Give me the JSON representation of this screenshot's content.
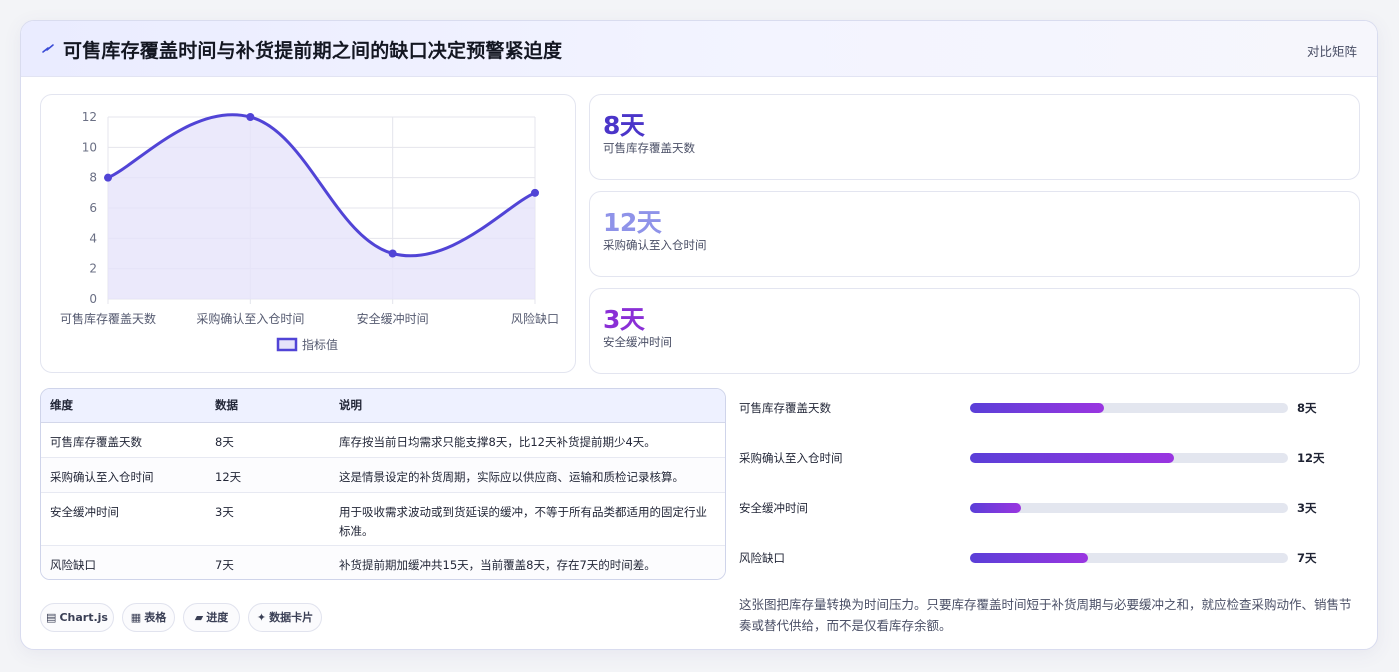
{
  "header": {
    "title": "可售库存覆盖时间与补货提前期之间的缺口决定预警紧迫度",
    "mode": "对比矩阵"
  },
  "chart_data": {
    "type": "line",
    "categories": [
      "可售库存覆盖天数",
      "采购确认至入仓时间",
      "安全缓冲时间",
      "风险缺口"
    ],
    "series": [
      {
        "name": "指标值",
        "values": [
          8,
          12,
          3,
          7
        ]
      }
    ],
    "ylim": [
      0,
      12
    ],
    "yticks": [
      0,
      2,
      4,
      6,
      8,
      10,
      12
    ],
    "grid": true,
    "legend": "bottom",
    "colors": {
      "line": "#5144d6",
      "fill": "#e6e3fa"
    }
  },
  "kpis": [
    {
      "value": "8天",
      "label": "可售库存覆盖天数",
      "color": "#4b35c9"
    },
    {
      "value": "12天",
      "label": "采购确认至入仓时间",
      "color": "#8f93e9"
    },
    {
      "value": "3天",
      "label": "安全缓冲时间",
      "color": "#8a2fd6"
    }
  ],
  "table": {
    "headers": [
      "维度",
      "数据",
      "说明"
    ],
    "rows": [
      [
        "可售库存覆盖天数",
        "8天",
        "库存按当前日均需求只能支撑8天，比12天补货提前期少4天。"
      ],
      [
        "采购确认至入仓时间",
        "12天",
        "这是情景设定的补货周期，实际应以供应商、运输和质检记录核算。"
      ],
      [
        "安全缓冲时间",
        "3天",
        "用于吸收需求波动或到货延误的缓冲，不等于所有品类都适用的固定行业标准。"
      ],
      [
        "风险缺口",
        "7天",
        "补货提前期加缓冲共15天，当前覆盖8天，存在7天的时间差。"
      ]
    ]
  },
  "progress": [
    {
      "label": "可售库存覆盖天数",
      "value": "8天",
      "fraction": 0.42
    },
    {
      "label": "采购确认至入仓时间",
      "value": "12天",
      "fraction": 0.64
    },
    {
      "label": "安全缓冲时间",
      "value": "3天",
      "fraction": 0.16
    },
    {
      "label": "风险缺口",
      "value": "7天",
      "fraction": 0.37
    }
  ],
  "tags": [
    {
      "icon": "chart-icon",
      "label": "Chart.js"
    },
    {
      "icon": "table-icon",
      "label": "表格"
    },
    {
      "icon": "progress-icon",
      "label": "进度"
    },
    {
      "icon": "sparkle-icon",
      "label": "数据卡片"
    }
  ],
  "note": "这张图把库存量转换为时间压力。只要库存覆盖时间短于补货周期与必要缓冲之和，就应检查采购动作、销售节奏或替代供给，而不是仅看库存余额。"
}
